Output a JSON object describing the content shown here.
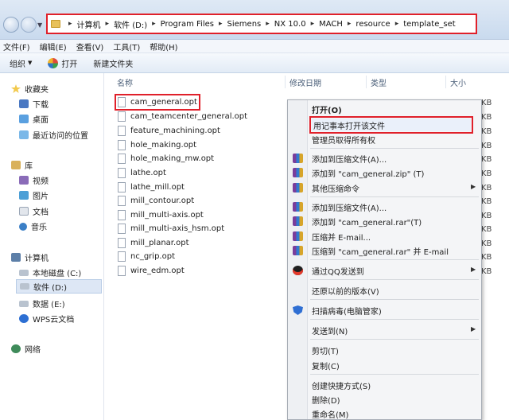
{
  "address": {
    "crumbs": [
      "计算机",
      "软件 (D:)",
      "Program Files",
      "Siemens",
      "NX 10.0",
      "MACH",
      "resource",
      "template_set"
    ]
  },
  "menubar": [
    "文件(F)",
    "编辑(E)",
    "查看(V)",
    "工具(T)",
    "帮助(H)"
  ],
  "toolbar": {
    "organize": "组织",
    "open": "打开",
    "new_folder": "新建文件夹"
  },
  "sidebar": {
    "favorites": {
      "header": "收藏夹",
      "items": [
        "下载",
        "桌面",
        "最近访问的位置"
      ]
    },
    "libraries": {
      "header": "库",
      "items": [
        "视频",
        "图片",
        "文档",
        "音乐"
      ]
    },
    "computer": {
      "header": "计算机",
      "items": [
        "本地磁盘 (C:)",
        "软件 (D:)",
        "数据 (E:)",
        "WPS云文档"
      ]
    },
    "network": "网络"
  },
  "columns": {
    "name": "名称",
    "modified": "修改日期",
    "type": "类型",
    "size": "大小"
  },
  "files": [
    "cam_general.opt",
    "cam_teamcenter_general.opt",
    "feature_machining.opt",
    "hole_making.opt",
    "hole_making_mw.opt",
    "lathe.opt",
    "lathe_mill.opt",
    "mill_contour.opt",
    "mill_multi-axis.opt",
    "mill_multi-axis_hsm.opt",
    "mill_planar.opt",
    "nc_grip.opt",
    "wire_edm.opt"
  ],
  "size_unit": "KB",
  "context_menu": {
    "open": "打开(O)",
    "open_notepad": "用记事本打开该文件",
    "take_ownership": "管理员取得所有权",
    "add_archive": "添加到压缩文件(A)...",
    "add_zip": "添加到 \"cam_general.zip\" (T)",
    "other_cmds": "其他压缩命令",
    "add_archive2": "添加到压缩文件(A)...",
    "add_rar": "添加到 \"cam_general.rar\"(T)",
    "compress_email": "压缩并 E-mail...",
    "compress_rar_email": "压缩到 \"cam_general.rar\" 并 E-mail",
    "send_qq": "通过QQ发送到",
    "restore": "还原以前的版本(V)",
    "scan": "扫描病毒(电脑管家)",
    "send_to": "发送到(N)",
    "cut": "剪切(T)",
    "copy": "复制(C)",
    "shortcut": "创建快捷方式(S)",
    "delete": "删除(D)",
    "rename": "重命名(M)"
  }
}
